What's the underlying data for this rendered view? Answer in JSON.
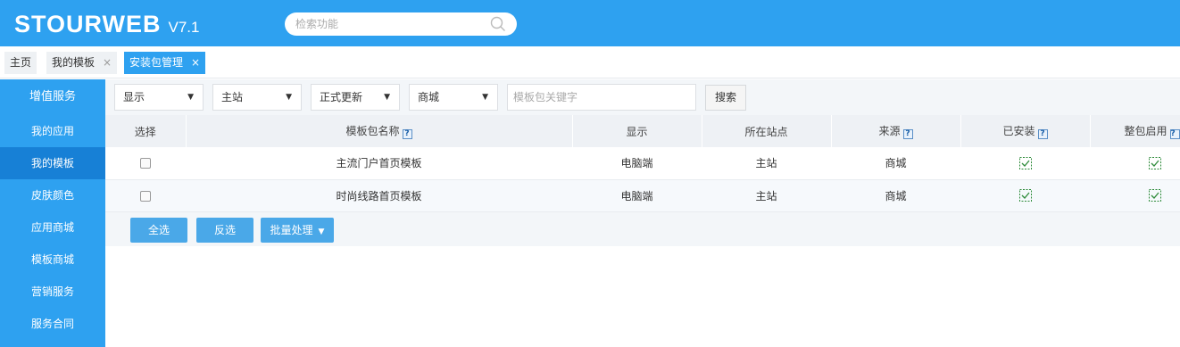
{
  "header": {
    "logo_text": "STOURWEB",
    "version": "V7.1",
    "search_placeholder": "检索功能"
  },
  "tabs": [
    {
      "label": "主页"
    },
    {
      "label": "我的模板",
      "close": "×"
    },
    {
      "label": "安装包管理",
      "close": "×"
    }
  ],
  "sidebar": {
    "title": "增值服务",
    "items": [
      {
        "label": "我的应用"
      },
      {
        "label": "我的模板"
      },
      {
        "label": "皮肤颜色"
      },
      {
        "label": "应用商城"
      },
      {
        "label": "模板商城"
      },
      {
        "label": "营销服务"
      },
      {
        "label": "服务合同"
      }
    ]
  },
  "filters": {
    "display": "显示",
    "site": "主站",
    "update": "正式更新",
    "source": "商城",
    "keyword_placeholder": "模板包关键字",
    "search_label": "搜索"
  },
  "table": {
    "headers": [
      "选择",
      "模板包名称",
      "显示",
      "所在站点",
      "来源",
      "已安装",
      "整包启用"
    ],
    "help_mark": "?",
    "rows": [
      {
        "name": "主流门户首页模板",
        "display": "电脑端",
        "site": "主站",
        "source": "商城",
        "installed": true,
        "enabled": true
      },
      {
        "name": "时尚线路首页模板",
        "display": "电脑端",
        "site": "主站",
        "source": "商城",
        "installed": true,
        "enabled": true
      }
    ]
  },
  "actions": {
    "select_all": "全选",
    "invert": "反选",
    "batch": "批量处理"
  },
  "colors": {
    "primary": "#2ea1f0",
    "sidebar_active": "#1780d6",
    "check_green": "#2e8b3a"
  }
}
